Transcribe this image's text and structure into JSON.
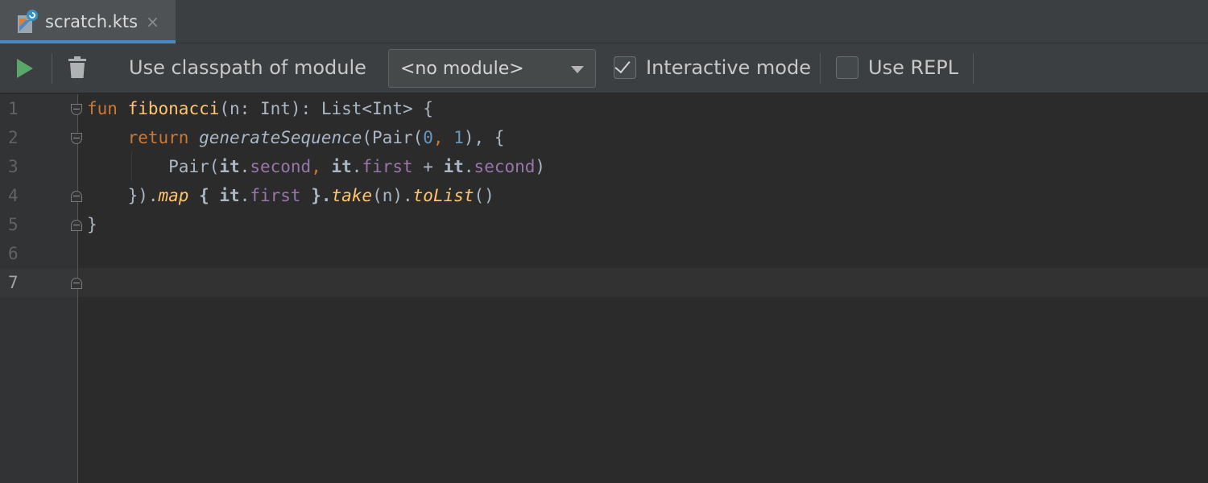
{
  "tab": {
    "label": "scratch.kts",
    "close": "×"
  },
  "toolbar": {
    "classpath_label": "Use classpath of module",
    "module_select_value": "<no module>",
    "interactive_label": "Interactive mode",
    "interactive_checked": true,
    "repl_label": "Use REPL",
    "repl_checked": false
  },
  "editor": {
    "line_numbers": [
      "1",
      "2",
      "3",
      "4",
      "5",
      "6",
      "7"
    ],
    "current_line": "7",
    "code": {
      "l1": {
        "kw": "fun",
        "fn": "fibonacci",
        "rest": "(n: Int): List<Int> {"
      },
      "l2": {
        "kw": "return",
        "call": "generateSequence",
        "p1": "(Pair(",
        "n0": "0",
        "comma": ", ",
        "n1": "1",
        "p2": "), {"
      },
      "l3": {
        "a": "Pair(",
        "it1": "it",
        "dot1": ".",
        "prop1": "second",
        "sep": ", ",
        "it2": "it",
        "dot2": ".",
        "prop2": "first",
        "plus": " + ",
        "it3": "it",
        "dot3": ".",
        "prop3": "second",
        "close": ")"
      },
      "l4": {
        "a": "}).",
        "map": "map",
        "b": " { ",
        "it": "it",
        "dot": ".",
        "prop": "first",
        "c": " }.",
        "take": "take",
        "d": "(n).",
        "tolist": "toList",
        "e": "()"
      },
      "l5": {
        "a": "}"
      }
    }
  },
  "colors": {
    "keyword": "#cc7832",
    "function": "#ffc66d",
    "number": "#6897bb",
    "property": "#9876aa",
    "text": "#a9b7c6",
    "accent": "#4a88c7",
    "run": "#59a869"
  }
}
